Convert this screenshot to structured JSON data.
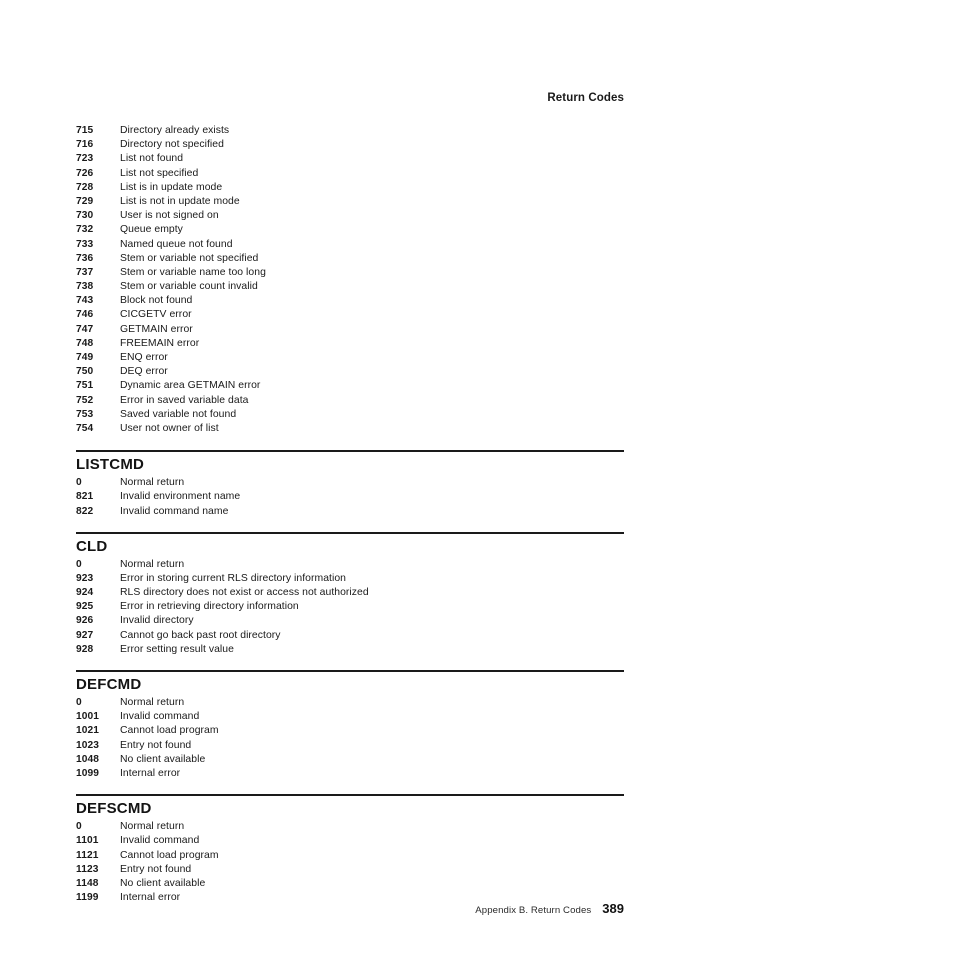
{
  "header": {
    "running_head": "Return Codes"
  },
  "footer": {
    "text": "Appendix B. Return Codes",
    "page_number": "389"
  },
  "colors": {
    "text": "#1a1a1a",
    "rule": "#1a1a1a",
    "background": "#ffffff"
  },
  "intro_block": {
    "rows": [
      {
        "code": "715",
        "description": "Directory already exists"
      },
      {
        "code": "716",
        "description": "Directory not specified"
      },
      {
        "code": "723",
        "description": "List not found"
      },
      {
        "code": "726",
        "description": "List not specified"
      },
      {
        "code": "728",
        "description": "List is in update mode"
      },
      {
        "code": "729",
        "description": "List is not in update mode"
      },
      {
        "code": "730",
        "description": "User is not signed on"
      },
      {
        "code": "732",
        "description": "Queue empty"
      },
      {
        "code": "733",
        "description": "Named queue not found"
      },
      {
        "code": "736",
        "description": "Stem or variable not specified"
      },
      {
        "code": "737",
        "description": "Stem or variable name too long"
      },
      {
        "code": "738",
        "description": "Stem or variable count invalid"
      },
      {
        "code": "743",
        "description": "Block not found"
      },
      {
        "code": "746",
        "description": "CICGETV error"
      },
      {
        "code": "747",
        "description": "GETMAIN error"
      },
      {
        "code": "748",
        "description": "FREEMAIN error"
      },
      {
        "code": "749",
        "description": "ENQ error"
      },
      {
        "code": "750",
        "description": "DEQ error"
      },
      {
        "code": "751",
        "description": "Dynamic area GETMAIN error"
      },
      {
        "code": "752",
        "description": "Error in saved variable data"
      },
      {
        "code": "753",
        "description": "Saved variable not found"
      },
      {
        "code": "754",
        "description": "User not owner of list"
      }
    ]
  },
  "sections": [
    {
      "heading": "LISTCMD",
      "rows": [
        {
          "code": "0",
          "description": "Normal return"
        },
        {
          "code": "821",
          "description": "Invalid environment name"
        },
        {
          "code": "822",
          "description": "Invalid command name"
        }
      ]
    },
    {
      "heading": "CLD",
      "rows": [
        {
          "code": "0",
          "description": "Normal return"
        },
        {
          "code": "923",
          "description": "Error in storing current RLS directory information"
        },
        {
          "code": "924",
          "description": "RLS directory does not exist or access not authorized"
        },
        {
          "code": "925",
          "description": "Error in retrieving directory information"
        },
        {
          "code": "926",
          "description": "Invalid directory"
        },
        {
          "code": "927",
          "description": "Cannot go back past root directory"
        },
        {
          "code": "928",
          "description": "Error setting result value"
        }
      ]
    },
    {
      "heading": "DEFCMD",
      "rows": [
        {
          "code": "0",
          "description": "Normal return"
        },
        {
          "code": "1001",
          "description": "Invalid command"
        },
        {
          "code": "1021",
          "description": "Cannot load program"
        },
        {
          "code": "1023",
          "description": "Entry not found"
        },
        {
          "code": "1048",
          "description": "No client available"
        },
        {
          "code": "1099",
          "description": "Internal error"
        }
      ]
    },
    {
      "heading": "DEFSCMD",
      "rows": [
        {
          "code": "0",
          "description": "Normal return"
        },
        {
          "code": "1101",
          "description": "Invalid command"
        },
        {
          "code": "1121",
          "description": "Cannot load program"
        },
        {
          "code": "1123",
          "description": "Entry not found"
        },
        {
          "code": "1148",
          "description": "No client available"
        },
        {
          "code": "1199",
          "description": "Internal error"
        }
      ]
    }
  ]
}
